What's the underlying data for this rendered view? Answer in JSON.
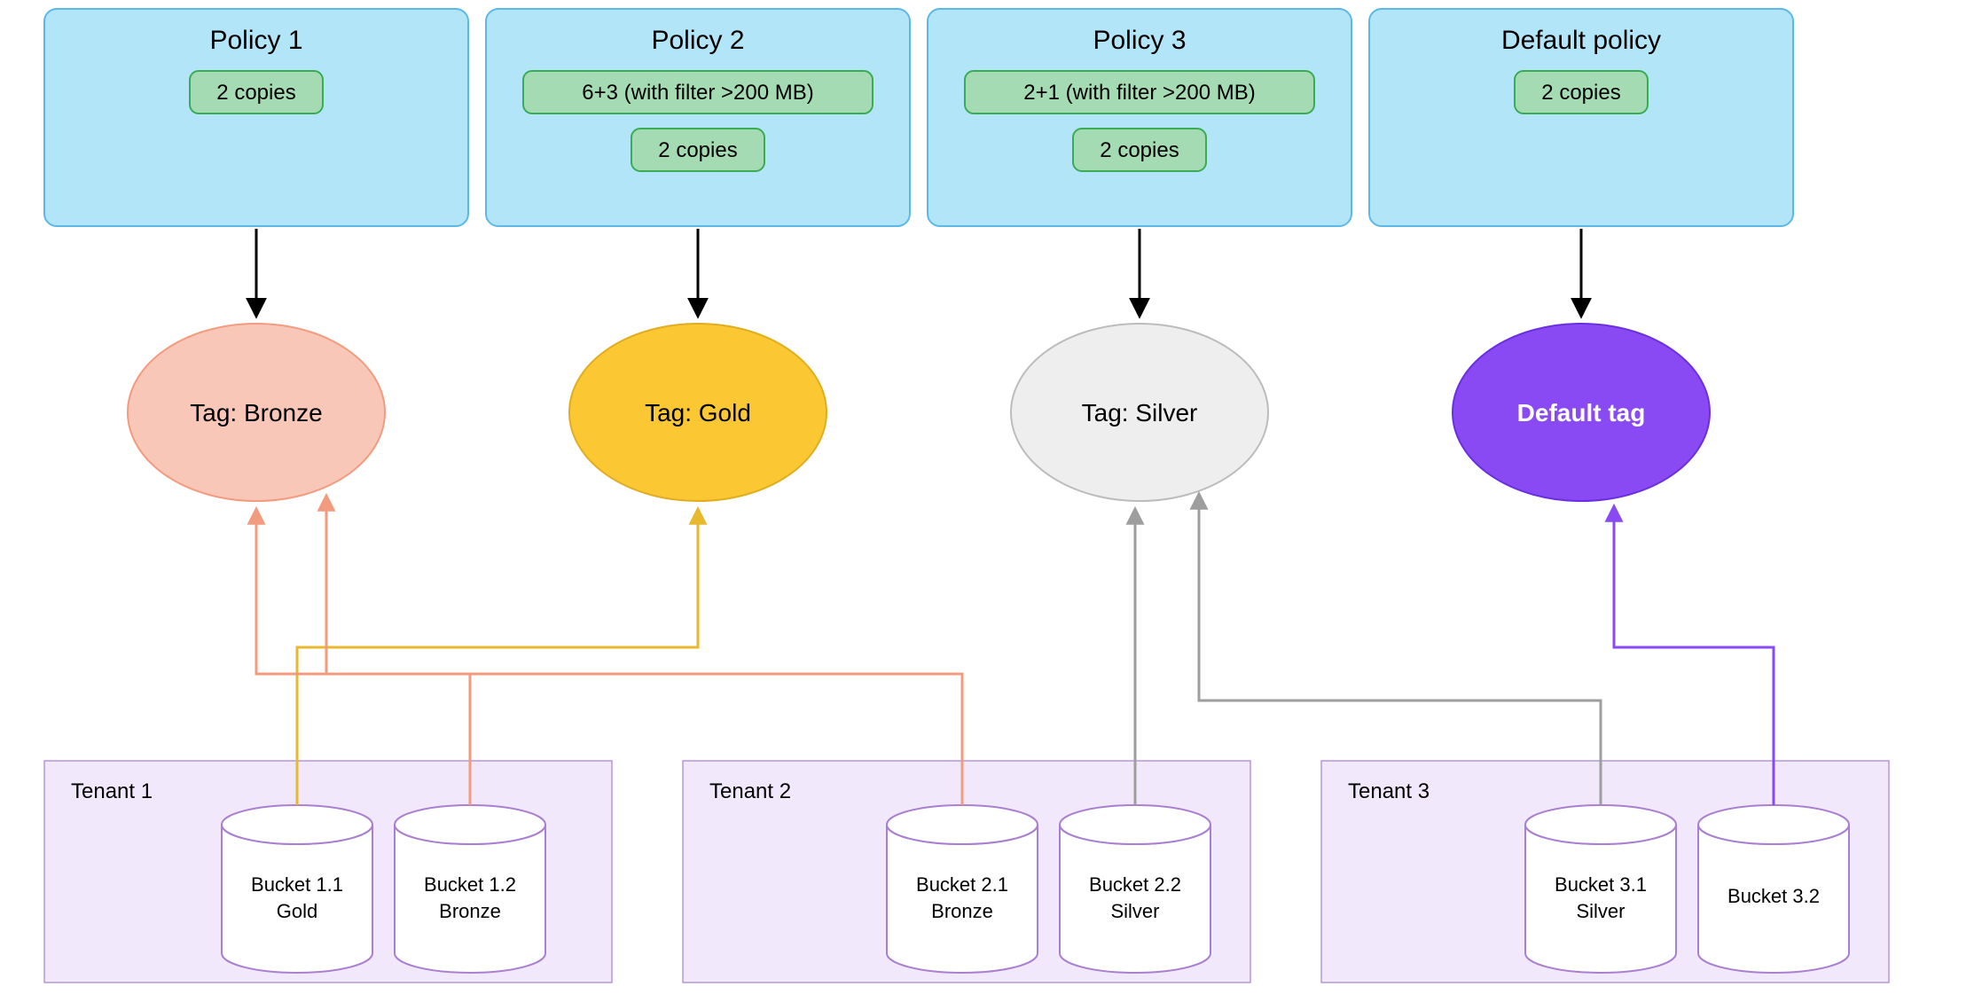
{
  "policies": [
    {
      "title": "Policy 1",
      "rules": [
        "2 copies"
      ]
    },
    {
      "title": "Policy 2",
      "rules": [
        "6+3 (with filter >200 MB)",
        "2 copies"
      ]
    },
    {
      "title": "Policy 3",
      "rules": [
        "2+1 (with filter >200 MB)",
        "2 copies"
      ]
    },
    {
      "title": "Default policy",
      "rules": [
        "2 copies"
      ]
    }
  ],
  "tags": [
    {
      "label": "Tag: Bronze",
      "fill": "#f9c7b8",
      "stroke": "#f29b7e",
      "textClass": "tag-text"
    },
    {
      "label": "Tag: Gold",
      "fill": "#fbc833",
      "stroke": "#e0ad1f",
      "textClass": "tag-text"
    },
    {
      "label": "Tag: Silver",
      "fill": "#eeeeee",
      "stroke": "#bcbcbc",
      "textClass": "tag-text"
    },
    {
      "label": "Default tag",
      "fill": "#8a4af3",
      "stroke": "#6a2fe0",
      "textClass": "tag-text-white"
    }
  ],
  "tenants": [
    {
      "label": "Tenant 1",
      "buckets": [
        {
          "line1": "Bucket 1.1",
          "line2": "Gold"
        },
        {
          "line1": "Bucket 1.2",
          "line2": "Bronze"
        }
      ]
    },
    {
      "label": "Tenant 2",
      "buckets": [
        {
          "line1": "Bucket 2.1",
          "line2": "Bronze"
        },
        {
          "line1": "Bucket 2.2",
          "line2": "Silver"
        }
      ]
    },
    {
      "label": "Tenant 3",
      "buckets": [
        {
          "line1": "Bucket 3.1",
          "line2": "Silver"
        },
        {
          "line1": "Bucket 3.2",
          "line2": ""
        }
      ]
    }
  ],
  "colors": {
    "gold": "#e8b82f",
    "bronze": "#f29b7e",
    "silver": "#9e9e9e",
    "purple": "#8a4af3"
  }
}
